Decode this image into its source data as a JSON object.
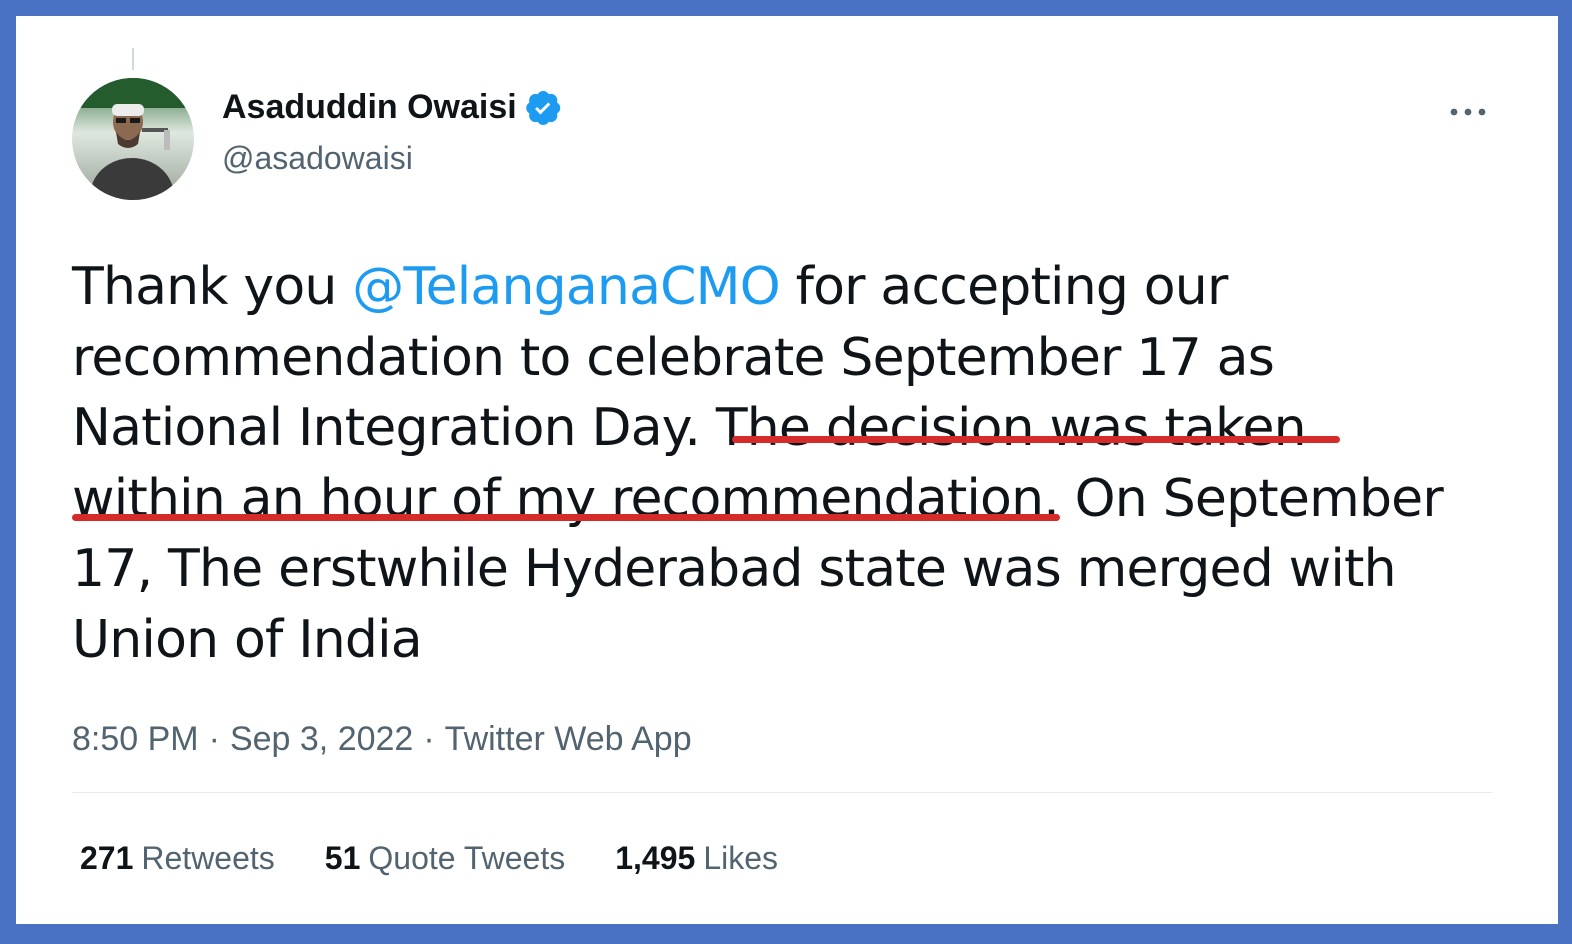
{
  "author": {
    "display_name": "Asaduddin Owaisi",
    "handle": "@asadowaisi",
    "verified": true
  },
  "tweet": {
    "lines": {
      "l1_a": "Thank you ",
      "l1_mention": "@TelanganaCMO",
      "l1_b": " for accepting our",
      "l2": "recommendation to celebrate September 17 as",
      "l3_a": "National Integration Day. ",
      "l3_b": "The decision was taken",
      "l4_a": "within an hour of my recommendation.",
      "l4_b": " On September",
      "l5": "17, The erstwhile Hyderabad state was merged with",
      "l6": "Union of India"
    }
  },
  "meta": {
    "time": "8:50 PM",
    "separator": "·",
    "date": "Sep 3, 2022",
    "source": "Twitter Web App"
  },
  "stats": {
    "retweets_count": "271",
    "retweets_label": "Retweets",
    "quotes_count": "51",
    "quotes_label": "Quote Tweets",
    "likes_count": "1,495",
    "likes_label": "Likes"
  },
  "colors": {
    "frame": "#4a72c4",
    "mention": "#1d9bf0",
    "underline": "#d62b2b",
    "verified": "#1d9bf0"
  },
  "icons": {
    "verified": "verified-badge-icon",
    "more": "more-horizontal-icon"
  }
}
